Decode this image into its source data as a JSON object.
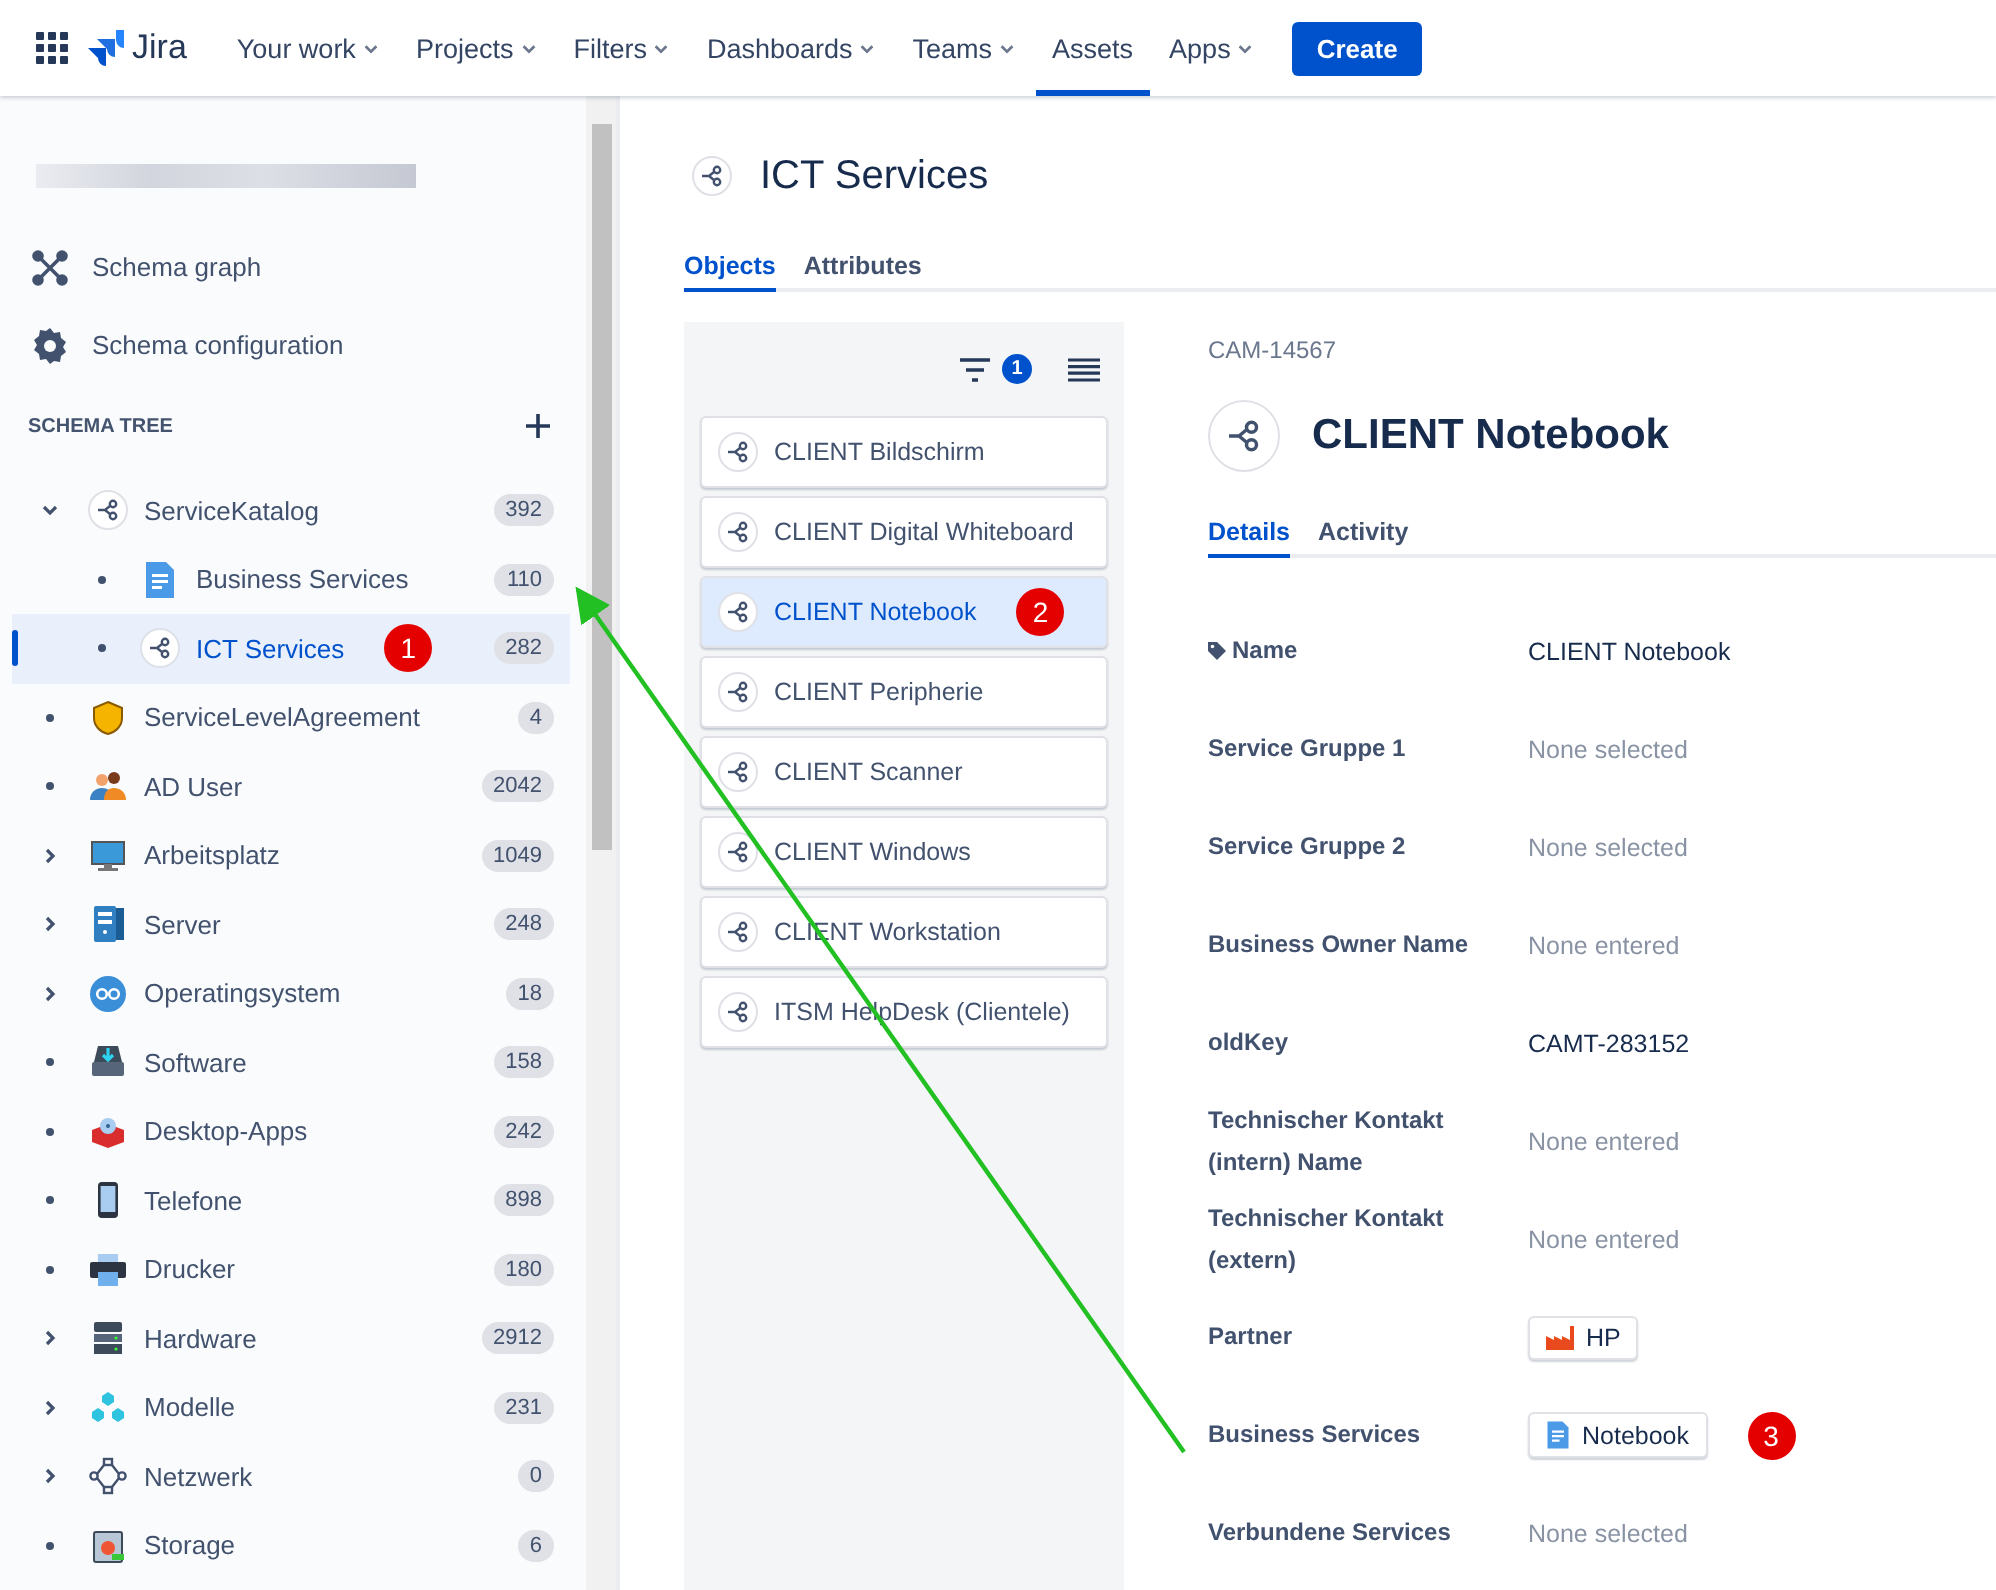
{
  "nav": {
    "logo": "Jira",
    "items": [
      {
        "label": "Your work",
        "dropdown": true,
        "selected": false
      },
      {
        "label": "Projects",
        "dropdown": true,
        "selected": false
      },
      {
        "label": "Filters",
        "dropdown": true,
        "selected": false
      },
      {
        "label": "Dashboards",
        "dropdown": true,
        "selected": false
      },
      {
        "label": "Teams",
        "dropdown": true,
        "selected": false
      },
      {
        "label": "Assets",
        "dropdown": false,
        "selected": true
      },
      {
        "label": "Apps",
        "dropdown": true,
        "selected": false
      }
    ],
    "create": "Create"
  },
  "sidebar": {
    "links": [
      "Schema graph",
      "Schema configuration"
    ],
    "tree_heading": "SCHEMA TREE",
    "tree": [
      {
        "label": "ServiceKatalog",
        "count": "392",
        "expanded": true,
        "selected": false,
        "children": [
          {
            "label": "Business Services",
            "count": "110",
            "selected": false
          },
          {
            "label": "ICT Services",
            "count": "282",
            "selected": true,
            "marker": "1"
          }
        ]
      },
      {
        "label": "ServiceLevelAgreement",
        "count": "4",
        "selected": false
      },
      {
        "label": "AD User",
        "count": "2042",
        "selected": false
      },
      {
        "label": "Arbeitsplatz",
        "count": "1049",
        "expanded": false,
        "selected": false
      },
      {
        "label": "Server",
        "count": "248",
        "expanded": false,
        "selected": false
      },
      {
        "label": "Operatingsystem",
        "count": "18",
        "expanded": false,
        "selected": false
      },
      {
        "label": "Software",
        "count": "158",
        "selected": false
      },
      {
        "label": "Desktop-Apps",
        "count": "242",
        "selected": false
      },
      {
        "label": "Telefone",
        "count": "898",
        "selected": false
      },
      {
        "label": "Drucker",
        "count": "180",
        "selected": false
      },
      {
        "label": "Hardware",
        "count": "2912",
        "expanded": false,
        "selected": false
      },
      {
        "label": "Modelle",
        "count": "231",
        "expanded": false,
        "selected": false
      },
      {
        "label": "Netzwerk",
        "count": "0",
        "expanded": false,
        "selected": false
      },
      {
        "label": "Storage",
        "count": "6",
        "selected": false
      }
    ]
  },
  "object_type": {
    "title": "ICT Services",
    "tabs": [
      {
        "label": "Objects",
        "selected": true
      },
      {
        "label": "Attributes",
        "selected": false
      }
    ],
    "filter_count": "1",
    "objects": [
      {
        "label": "CLIENT Bildschirm",
        "selected": false
      },
      {
        "label": "CLIENT Digital Whiteboard",
        "selected": false
      },
      {
        "label": "CLIENT Notebook",
        "selected": true,
        "marker": "2"
      },
      {
        "label": "CLIENT Peripherie",
        "selected": false
      },
      {
        "label": "CLIENT Scanner",
        "selected": false
      },
      {
        "label": "CLIENT Windows",
        "selected": false
      },
      {
        "label": "CLIENT Workstation",
        "selected": false
      },
      {
        "label": "ITSM HelpDesk (Clientele)",
        "selected": false
      }
    ]
  },
  "object": {
    "key": "CAM-14567",
    "title": "CLIENT Notebook",
    "tabs": [
      {
        "label": "Details",
        "selected": true
      },
      {
        "label": "Activity",
        "selected": false
      }
    ],
    "attributes": [
      {
        "label": "Name",
        "kind": "name",
        "value": "CLIENT Notebook"
      },
      {
        "label": "Service Gruppe 1",
        "kind": "empty",
        "value": "None selected"
      },
      {
        "label": "Service Gruppe 2",
        "kind": "empty",
        "value": "None selected"
      },
      {
        "label": "Business Owner Name",
        "kind": "empty",
        "value": "None entered"
      },
      {
        "label": "oldKey",
        "kind": "text",
        "value": "CAMT-283152"
      },
      {
        "label": "Technischer Kontakt (intern) Name",
        "kind": "empty",
        "value": "None entered"
      },
      {
        "label": "Technischer Kontakt (extern)",
        "kind": "empty",
        "value": "None entered"
      },
      {
        "label": "Partner",
        "kind": "company",
        "value": "HP"
      },
      {
        "label": "Business Services",
        "kind": "service",
        "value": "Notebook",
        "marker": "3"
      },
      {
        "label": "Verbundene Services",
        "kind": "empty",
        "value": "None selected"
      }
    ]
  }
}
